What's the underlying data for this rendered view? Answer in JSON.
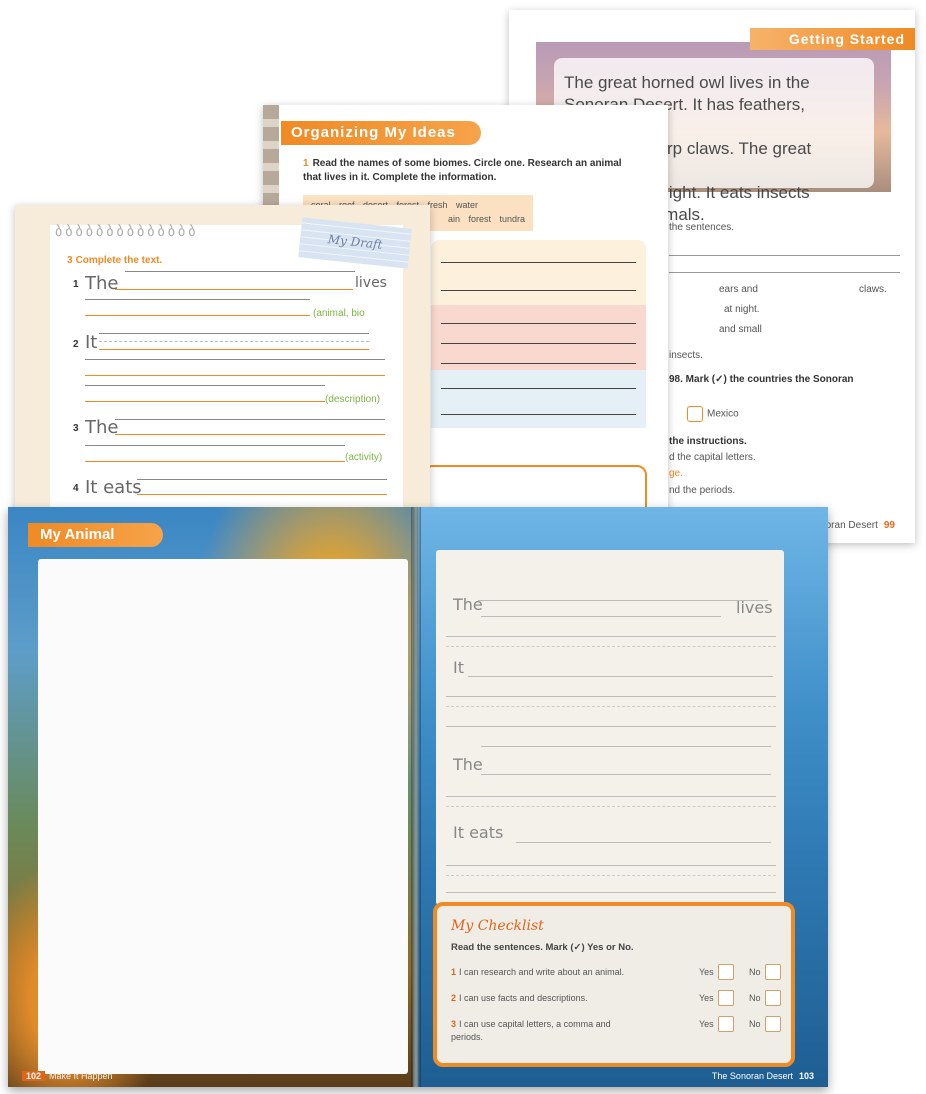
{
  "getting_started": {
    "banner": "Getting Started",
    "paragraph_lines": [
      "The great horned owl lives in the",
      "Sonoran Desert. It has feathers, pointed",
      "ears, and sharp claws. The great horned",
      "owl hunts at night. It eats insects",
      "and small animals."
    ],
    "row1_text": "the sentences.",
    "row2_mid": "ears and",
    "row2_end": "claws.",
    "row3_text": "at night.",
    "row4_text": "and small",
    "row5_text": "insects.",
    "q_text": "98. Mark (✓) the countries the Sonoran",
    "mexico": "Mexico",
    "instr": "the instructions.",
    "instr1": "d the capital letters.",
    "instr2": "ge.",
    "instr3": "nd the periods.",
    "footer_text": "oran Desert",
    "page_num": "99"
  },
  "organizing": {
    "banner": "Organizing My Ideas",
    "num": "1",
    "instruction": "Read the names of some biomes. Circle one. Research an animal that lives in it. Complete the information.",
    "biomes_line1": "coral reef   desert   forest   fresh water",
    "biomes_line2": "ain forest   tundra"
  },
  "notebook": {
    "sticky": "My Draft",
    "num": "3",
    "title": "Complete the text.",
    "items": [
      {
        "num": "1",
        "word": "The",
        "end": "lives",
        "hint": "(animal, bio"
      },
      {
        "num": "2",
        "word": "It",
        "hint": "(description)"
      },
      {
        "num": "3",
        "word": "The",
        "hint": "(activity)"
      },
      {
        "num": "4",
        "word": "It eats"
      }
    ]
  },
  "book": {
    "banner": "My Animal",
    "writing": {
      "w1": "The",
      "w1_end": "lives",
      "w2": "It",
      "w3": "The",
      "w4": "It eats"
    },
    "checklist": {
      "title": "My Checklist",
      "instruction": "Read the sentences. Mark (✓) Yes or No.",
      "items": [
        {
          "num": "1",
          "text": "I can research and write about an animal."
        },
        {
          "num": "2",
          "text": "I can use facts and descriptions."
        },
        {
          "num": "3",
          "text": "I can use capital letters, a comma and periods."
        }
      ],
      "yes": "Yes",
      "no": "No"
    },
    "footer_left_num": "102",
    "footer_left_text": "Make It Happen",
    "footer_right_text": "The Sonoran Desert",
    "footer_right_num": "103"
  }
}
